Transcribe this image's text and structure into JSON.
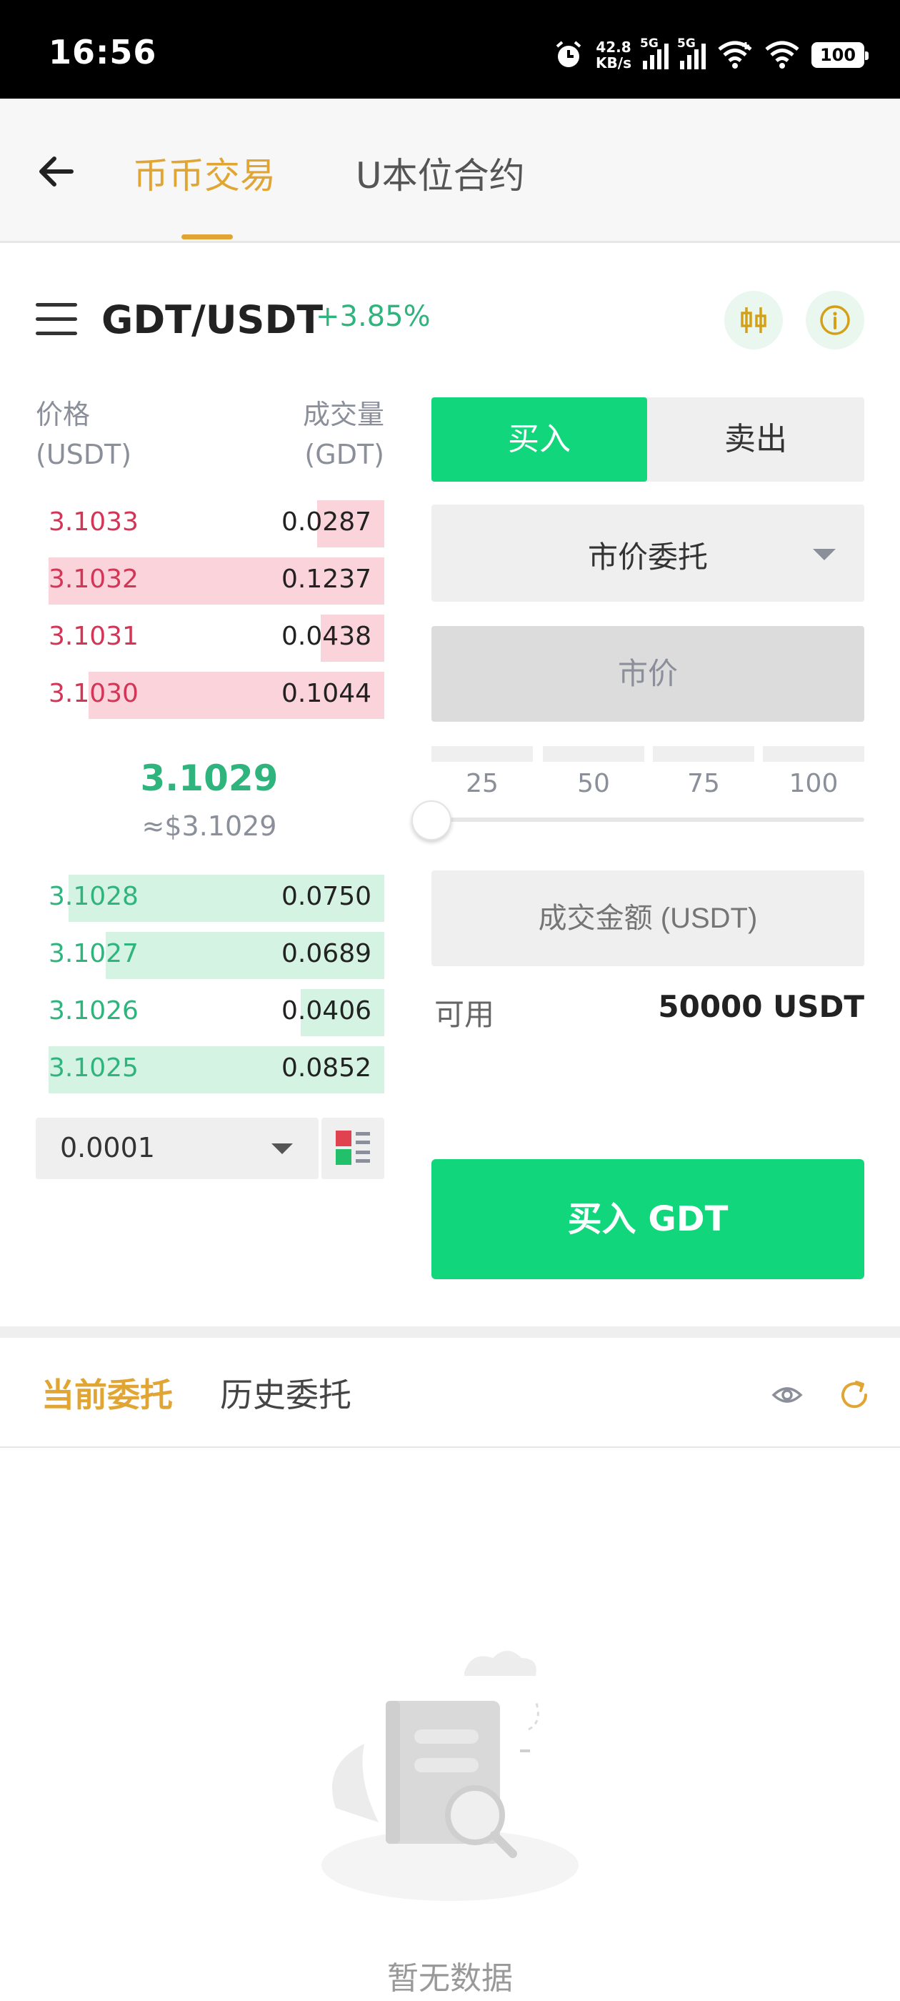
{
  "status_bar": {
    "time": "16:56",
    "net_speed_value": "42.8",
    "net_speed_unit": "KB/s",
    "sim1_tag": "5G",
    "sim2_tag": "5G",
    "battery": "100",
    "icons": [
      "alarm-icon",
      "signal-icon",
      "wifi-icon",
      "battery-icon"
    ]
  },
  "header": {
    "tabs": [
      {
        "label": "币币交易",
        "active": true
      },
      {
        "label": "U本位合约",
        "active": false
      }
    ],
    "accent_color": "#e0a532"
  },
  "pair": {
    "symbol": "GDT/USDT",
    "change": "+3.85%",
    "change_color": "#2fb47d"
  },
  "order_book": {
    "price_header_line1": "价格",
    "price_header_line2": "(USDT)",
    "qty_header_line1": "成交量",
    "qty_header_line2": "(GDT)",
    "asks": [
      {
        "price": "3.1033",
        "qty": "0.0287",
        "depth": 0.2
      },
      {
        "price": "3.1032",
        "qty": "0.1237",
        "depth": 1.0
      },
      {
        "price": "3.1031",
        "qty": "0.0438",
        "depth": 0.19
      },
      {
        "price": "3.1030",
        "qty": "0.1044",
        "depth": 0.88
      }
    ],
    "last_price": "3.1029",
    "last_price_usd": "≈$3.1029",
    "bids": [
      {
        "price": "3.1028",
        "qty": "0.0750",
        "depth": 0.94
      },
      {
        "price": "3.1027",
        "qty": "0.0689",
        "depth": 0.83
      },
      {
        "price": "3.1026",
        "qty": "0.0406",
        "depth": 0.25
      },
      {
        "price": "3.1025",
        "qty": "0.0852",
        "depth": 1.0
      }
    ],
    "precision": "0.0001",
    "ask_color": "#d33556",
    "bid_color": "#2fb47d"
  },
  "order_form": {
    "buy_label": "买入",
    "sell_label": "卖出",
    "order_type": "市价委托",
    "price_field": "市价",
    "percent_options": [
      "25",
      "50",
      "75",
      "100"
    ],
    "slider_value": 0,
    "amount_placeholder": "成交金额 (USDT)",
    "available_label": "可用",
    "available_value": "50000 USDT",
    "submit_label": "买入 GDT",
    "buy_color": "#12d67c"
  },
  "orders": {
    "tabs": [
      {
        "label": "当前委托",
        "active": true
      },
      {
        "label": "历史委托",
        "active": false
      }
    ],
    "empty_text": "暂无数据"
  }
}
